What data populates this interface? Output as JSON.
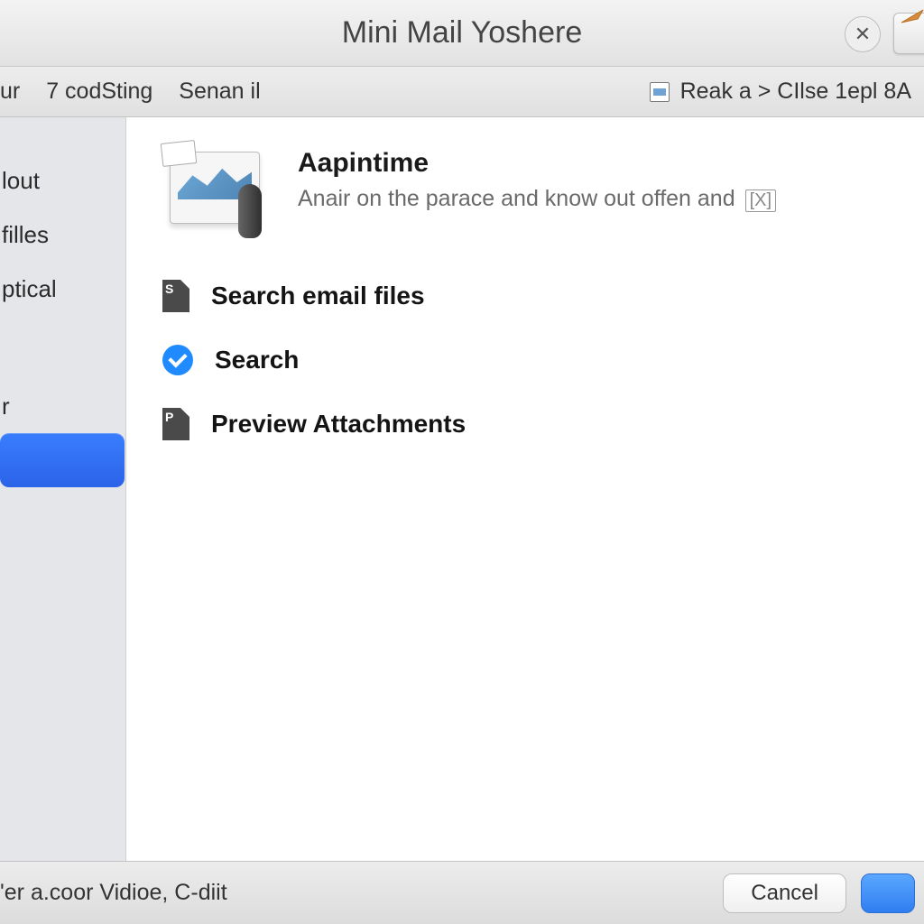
{
  "window": {
    "title": "Mini Mail Yoshere"
  },
  "toolbar": {
    "left": {
      "item0": "ur",
      "item1": "7 codSting",
      "item2": "Senan il"
    },
    "right": {
      "breadcrumb": "Reak a > CIlse 1epl 8A"
    }
  },
  "sidebar": {
    "items": {
      "0": {
        "label": "lout"
      },
      "1": {
        "label": "filles"
      },
      "2": {
        "label": "ptical"
      },
      "3": {
        "label": "r"
      },
      "4": {
        "label": ""
      }
    }
  },
  "content": {
    "hero": {
      "title": "Aapintime",
      "subtitle": "Anair on the parace and know out offen and",
      "trail": "[X]"
    },
    "options": {
      "0": {
        "icon_letter": "S",
        "label": "Search email files"
      },
      "1": {
        "label": "Search"
      },
      "2": {
        "icon_letter": "P",
        "label": "Preview Attachments"
      }
    }
  },
  "footer": {
    "status": "'er a.coor Vidioe, C-diit",
    "cancel": "Cancel",
    "primary": ""
  }
}
